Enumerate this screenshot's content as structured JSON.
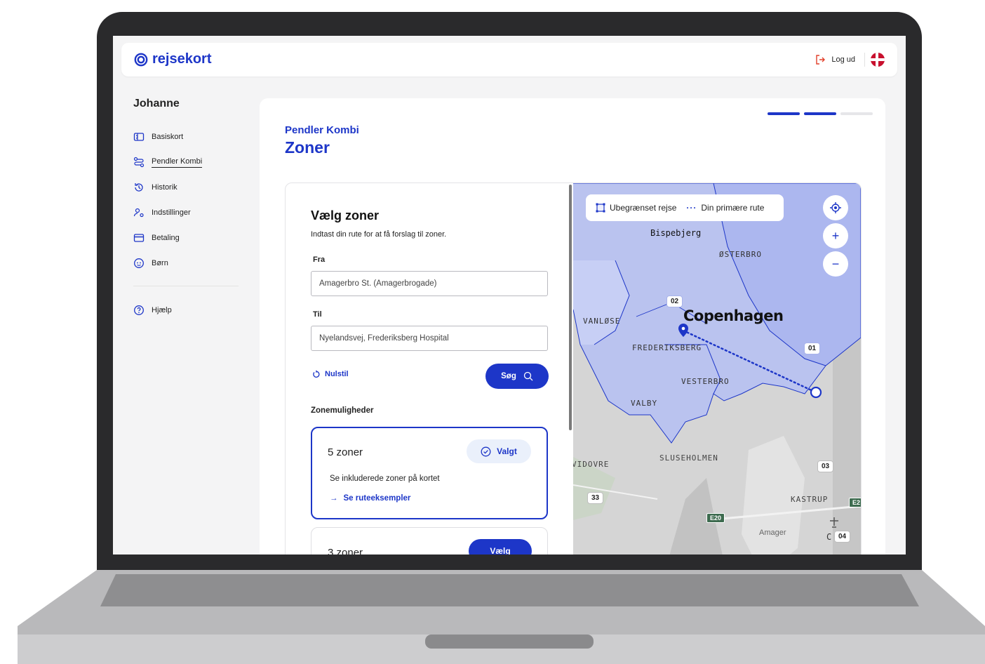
{
  "header": {
    "logo_text": "rejsekort",
    "logout_label": "Log ud",
    "brand_color": "#1d36c8"
  },
  "sidebar": {
    "user_name": "Johanne",
    "items": [
      {
        "label": "Basiskort",
        "icon": "card-icon"
      },
      {
        "label": "Pendler Kombi",
        "icon": "route-icon",
        "active": true
      },
      {
        "label": "Historik",
        "icon": "history-icon"
      },
      {
        "label": "Indstillinger",
        "icon": "settings-icon"
      },
      {
        "label": "Betaling",
        "icon": "payment-icon"
      },
      {
        "label": "Børn",
        "icon": "child-icon"
      }
    ],
    "help_label": "Hjælp"
  },
  "progress": {
    "total": 3,
    "completed": 2
  },
  "page": {
    "eyebrow": "Pendler Kombi",
    "title": "Zoner"
  },
  "form": {
    "heading": "Vælg zoner",
    "subtitle": "Indtast din rute for at få forslag til zoner.",
    "from_label": "Fra",
    "from_value": "Amagerbro St. (Amagerbrogade)",
    "to_label": "Til",
    "to_value": "Nyelandsvej, Frederiksberg Hospital",
    "reset_label": "Nulstil",
    "search_label": "Søg"
  },
  "zones": {
    "section_title": "Zonemuligheder",
    "options": [
      {
        "name": "5 zoner",
        "status_label": "Valgt",
        "description": "Se inkluderede zoner på kortet",
        "link": "Se ruteeksempler"
      },
      {
        "name": "3 zoner",
        "action_label": "Vælg"
      }
    ]
  },
  "map": {
    "legend_unlimited": "Ubegrænset rejse",
    "legend_route": "Din primære rute",
    "city_label": "Copenhagen",
    "areas": [
      "Bispebjerg",
      "ØSTERBRO",
      "VANLØSE",
      "FREDERIKSBERG",
      "VESTERBRO",
      "VALBY",
      "SLUSEHOLMEN",
      "VIDOVRE",
      "KASTRUP",
      "Amager"
    ],
    "zone_badges": [
      "02",
      "01",
      "03",
      "04"
    ],
    "road_labels": [
      "33",
      "E20",
      "E2"
    ],
    "partial_label": "C"
  }
}
